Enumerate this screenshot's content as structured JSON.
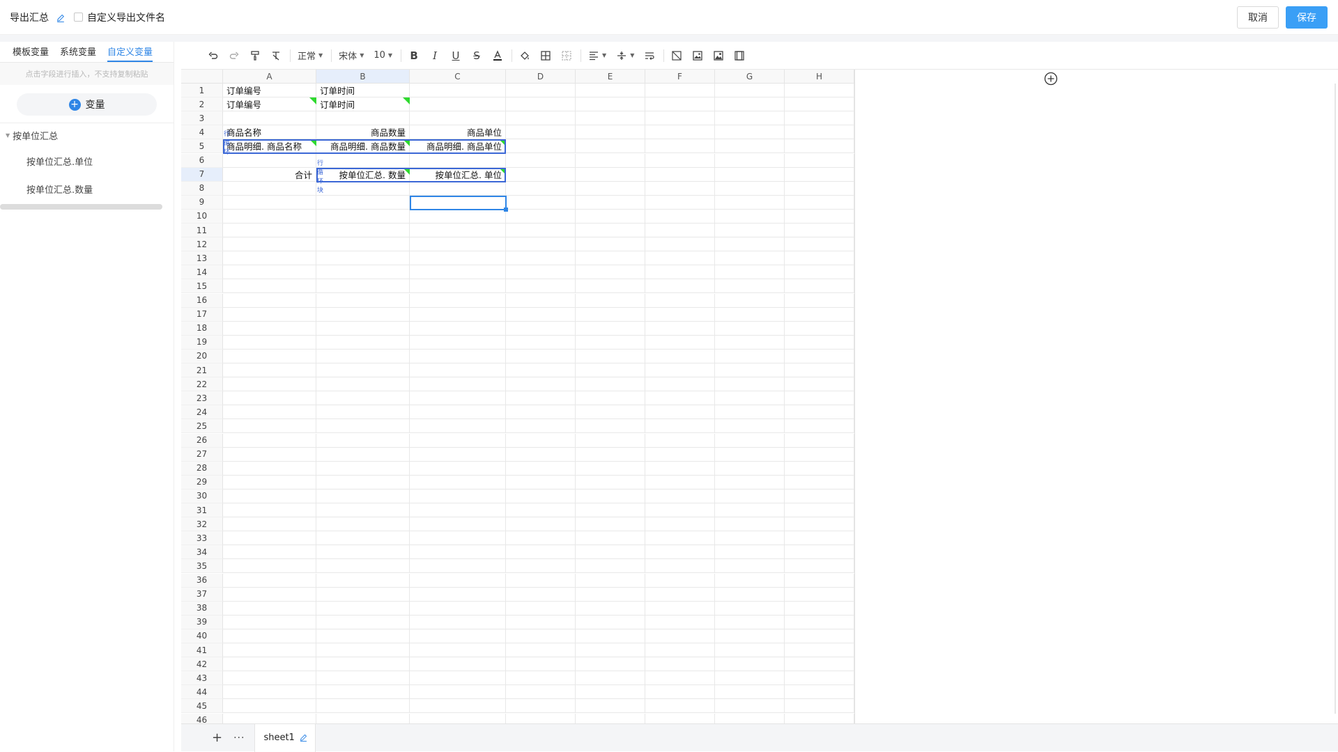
{
  "topbar": {
    "title": "导出汇总",
    "custom_filename_label": "自定义导出文件名",
    "cancel_label": "取消",
    "save_label": "保存"
  },
  "left_panel": {
    "tabs": [
      {
        "label": "模板变量",
        "active": false
      },
      {
        "label": "系统变量",
        "active": false
      },
      {
        "label": "自定义变量",
        "active": true
      }
    ],
    "hint": "点击字段进行插入，不支持复制粘贴",
    "add_variable_label": "变量",
    "tree": {
      "group_label": "按单位汇总",
      "items": [
        "按单位汇总.单位",
        "按单位汇总.数量"
      ]
    }
  },
  "toolbar": {
    "style_select": "正常",
    "font_select": "宋体",
    "size_select": "10"
  },
  "sheet": {
    "columns": [
      "A",
      "B",
      "C",
      "D",
      "E",
      "F",
      "G",
      "H"
    ],
    "rows": [
      "1",
      "2",
      "3",
      "4",
      "5",
      "6",
      "7",
      "8",
      "9",
      "10",
      "11",
      "12",
      "13",
      "14",
      "15",
      "16",
      "17",
      "18",
      "19",
      "20",
      "21",
      "22",
      "23",
      "24",
      "25",
      "26",
      "27",
      "28",
      "29",
      "30",
      "31",
      "32",
      "33",
      "34",
      "35",
      "36",
      "37",
      "38",
      "39",
      "40",
      "41",
      "42",
      "43",
      "44",
      "45",
      "46"
    ],
    "cells": {
      "a1": "订单编号",
      "b1": "订单时间",
      "a2": "订单编号",
      "b2": "订单时间",
      "a4": "商品名称",
      "b4": "商品数量",
      "c4": "商品单位",
      "a5": "商品明细. 商品名称",
      "b5": "商品明细. 商品数量",
      "c5": "商品明细. 商品单位",
      "a7": "合计",
      "b7": "按单位汇总. 数量",
      "c7": "按单位汇总. 单位"
    },
    "loop_label": "行循环块",
    "loop_label_small": "行循环"
  },
  "bottom": {
    "sheet_tab": "sheet1"
  },
  "colors": {
    "accent": "#3a9ff6",
    "flag": "#2fd92f",
    "block_border": "#3b67d6"
  }
}
